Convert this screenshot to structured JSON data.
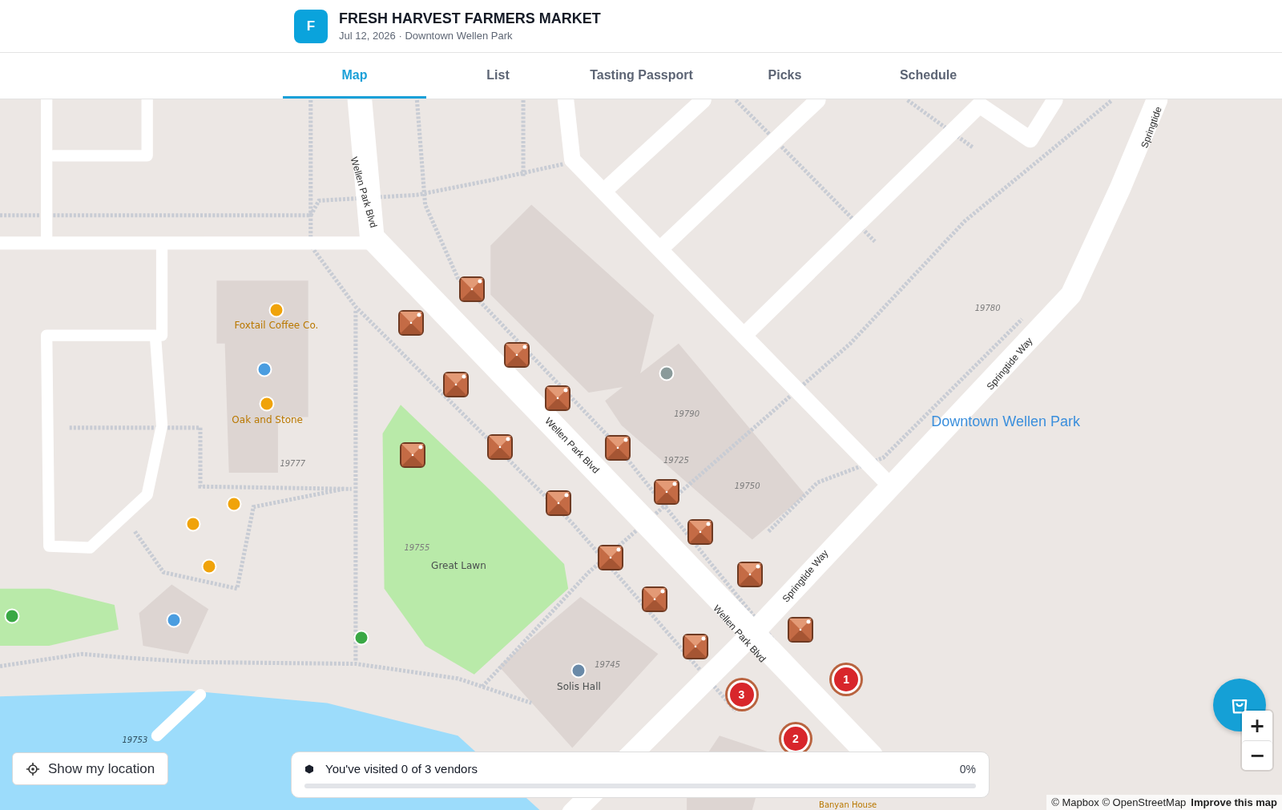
{
  "app": {
    "logo_letter": "F",
    "title": "FRESH HARVEST FARMERS MARKET",
    "subtitle": "Jul 12, 2026 · Downtown Wellen Park"
  },
  "tabs": [
    {
      "label": "Map",
      "selected": true
    },
    {
      "label": "List",
      "selected": false
    },
    {
      "label": "Tasting Passport",
      "selected": false
    },
    {
      "label": "Picks",
      "selected": false
    },
    {
      "label": "Schedule",
      "selected": false
    }
  ],
  "map": {
    "labels": [
      {
        "text": "Wellen Park Blvd",
        "kind": "street"
      },
      {
        "text": "Wellen Park Blvd",
        "kind": "street"
      },
      {
        "text": "Wellen Park Blvd",
        "kind": "street"
      },
      {
        "text": "Springtide Way",
        "kind": "street"
      },
      {
        "text": "Springtide Way",
        "kind": "street"
      },
      {
        "text": "Springtide",
        "kind": "street"
      },
      {
        "text": "Foxtail Coffee Co.",
        "kind": "poi"
      },
      {
        "text": "Oak and Stone",
        "kind": "poi"
      },
      {
        "text": "Great Lawn",
        "kind": "place"
      },
      {
        "text": "Solis Hall",
        "kind": "place"
      },
      {
        "text": "Downtown Wellen Park",
        "kind": "area"
      },
      {
        "text": "Banyan House",
        "kind": "poi"
      },
      {
        "text": "19780",
        "kind": "address"
      },
      {
        "text": "19790",
        "kind": "address"
      },
      {
        "text": "19725",
        "kind": "address"
      },
      {
        "text": "19750",
        "kind": "address"
      },
      {
        "text": "19777",
        "kind": "address"
      },
      {
        "text": "19755",
        "kind": "address"
      },
      {
        "text": "19745",
        "kind": "address"
      },
      {
        "text": "19753",
        "kind": "address"
      }
    ],
    "stops": [
      {
        "number": "1"
      },
      {
        "number": "3"
      },
      {
        "number": "2"
      }
    ]
  },
  "location_button": {
    "label": "Show my location"
  },
  "progress": {
    "label": "You've visited 0 of 3 vendors",
    "percent": "0%",
    "level": 0
  },
  "zoom_controls": {
    "zoom_in": "+",
    "zoom_out": "−"
  },
  "attribution": {
    "text": "© Mapbox © OpenStreetMap",
    "link": "Improve this map"
  }
}
